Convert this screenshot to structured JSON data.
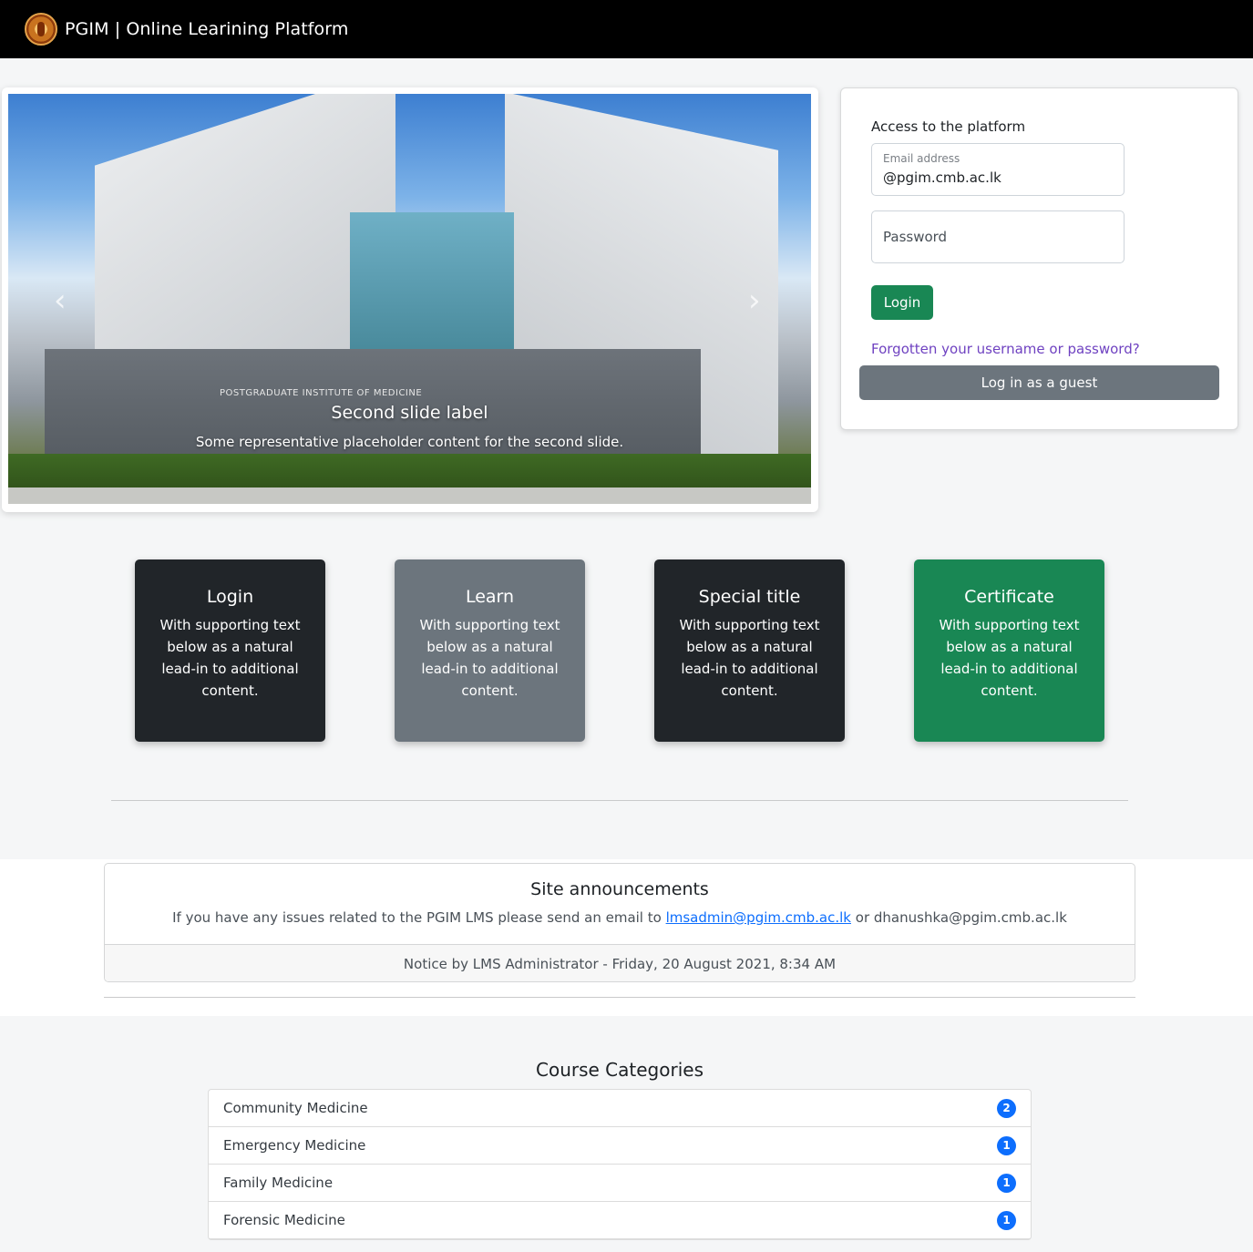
{
  "navbar": {
    "title": "PGIM | Online Learining Platform",
    "logo_icon": "pgim-crest-logo"
  },
  "carousel": {
    "building_sign": "POSTGRADUATE INSTITUTE OF MEDICINE",
    "caption_title": "Second slide label",
    "caption_text": "Some representative placeholder content for the second slide.",
    "prev_icon": "‹",
    "next_icon": "›"
  },
  "login": {
    "heading": "Access to the platform",
    "email_label": "Email address",
    "email_value": "@pgim.cmb.ac.lk",
    "password_placeholder": "Password",
    "login_button": "Login",
    "forgot_link": "Forgotten your username or password?",
    "guest_button": "Log in as a guest"
  },
  "features": [
    {
      "title": "Login",
      "text": "With supporting text below as a natural lead-in to additional content."
    },
    {
      "title": "Learn",
      "text": "With supporting text below as a natural lead-in to additional content."
    },
    {
      "title": "Special title",
      "text": "With supporting text below as a natural lead-in to additional content."
    },
    {
      "title": "Certificate",
      "text": "With supporting text below as a natural lead-in to additional content."
    }
  ],
  "announcements": {
    "title": "Site announcements",
    "body_prefix": "If you have any issues related to the PGIM LMS please send an email to",
    "link_email": "lmsadmin@pgim.cmb.ac.lk",
    "body_middle": "or",
    "body_suffix": "dhanushka@pgim.cmb.ac.lk",
    "footer": "Notice by LMS Administrator - Friday, 20 August 2021, 8:34 AM"
  },
  "categories": {
    "heading": "Course Categories",
    "items": [
      {
        "name": "Community Medicine",
        "count": "2"
      },
      {
        "name": "Emergency Medicine",
        "count": "1"
      },
      {
        "name": "Family Medicine",
        "count": "1"
      },
      {
        "name": "Forensic Medicine",
        "count": "1"
      }
    ]
  },
  "colors": {
    "navbar_bg": "#000000",
    "success_green": "#198754",
    "secondary_gray": "#6c757d",
    "dark": "#212529",
    "primary_blue": "#0d6efd",
    "link_purple": "#6f42c1"
  }
}
